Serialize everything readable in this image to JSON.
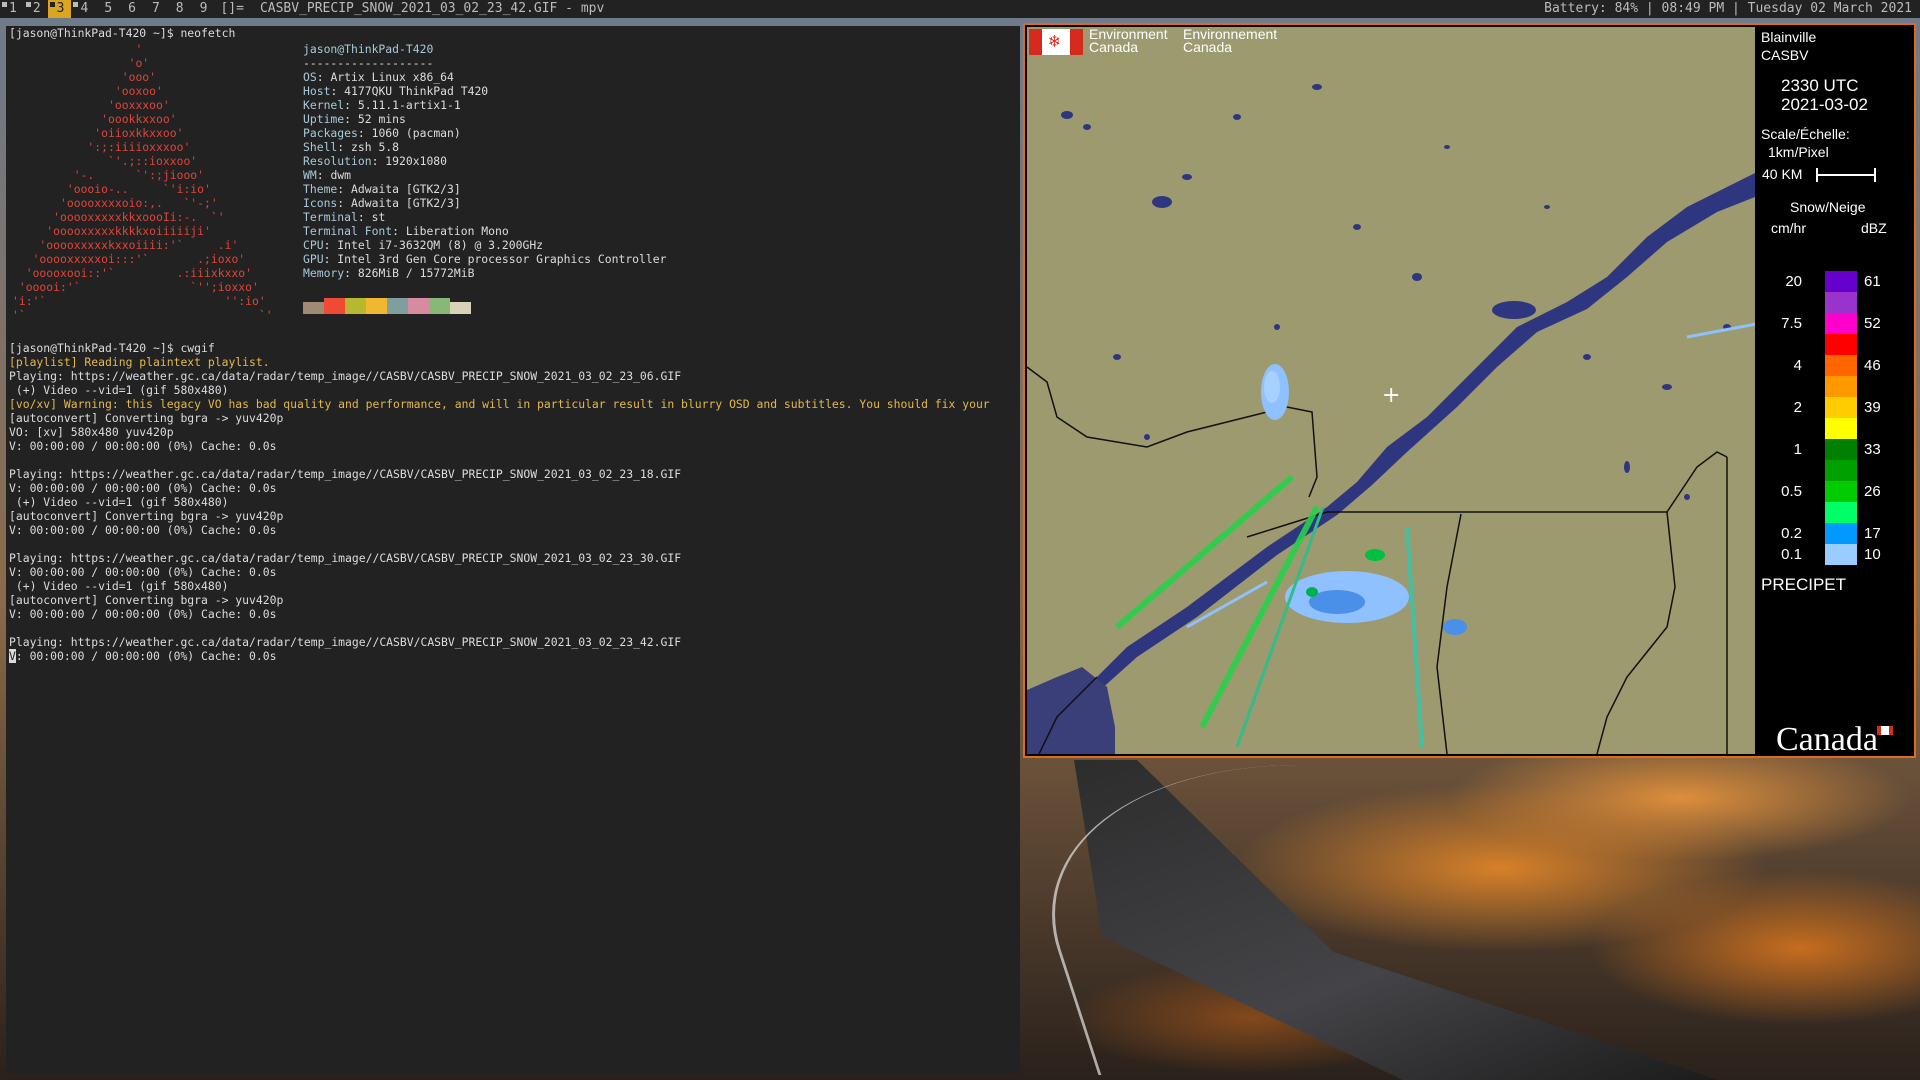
{
  "bar": {
    "tags": [
      {
        "label": "1",
        "occupied": true,
        "selected": false
      },
      {
        "label": "2",
        "occupied": true,
        "selected": false
      },
      {
        "label": "3",
        "occupied": true,
        "selected": true
      },
      {
        "label": "4",
        "occupied": true,
        "selected": false
      },
      {
        "label": "5",
        "occupied": false,
        "selected": false
      },
      {
        "label": "6",
        "occupied": false,
        "selected": false
      },
      {
        "label": "7",
        "occupied": false,
        "selected": false
      },
      {
        "label": "8",
        "occupied": false,
        "selected": false
      },
      {
        "label": "9",
        "occupied": false,
        "selected": false
      }
    ],
    "layout": "[]=",
    "title": "CASBV_PRECIP_SNOW_2021_03_02_23_42.GIF - mpv",
    "status": "Battery: 84% | 08:49 PM | Tuesday 02 March 2021",
    "colors": {
      "bg": "#222222",
      "fg": "#bbbbbb",
      "accent": "#daa520"
    }
  },
  "terminal": {
    "prompt1": "[jason@ThinkPad-T420 ~]$ neofetch",
    "ascii_art": "                  '\n                 'o'\n                'ooo'\n               'ooxoo'\n              'ooxxxoo'\n             'oookkxxoo'\n            'oiioxkkxxoo'\n           ':;:iiiioxxxoo'\n              `'.;::ioxxoo'\n         '-.      `':;jiooo'\n        'oooio-..     `'i:io'\n       'ooooxxxxoio:,.   `'-;'\n      'ooooxxxxxkkxoooIi:-.  `'\n     'ooooxxxxxkkkkxoiiiiiji'\n    'ooooxxxxxkxxoiiii:'`     .i'\n   'ooooxxxxxoi:::'`       .;ioxo'\n  'ooooxooi::'`         .:iiixkxxo'\n 'ooooi:'`                `'';ioxxo'\n'i:'`                          '':io'\n'`                                  `'",
    "user": "jason@ThinkPad-T420",
    "separator": "-------------------",
    "info": [
      {
        "key": "OS",
        "value": "Artix Linux x86_64"
      },
      {
        "key": "Host",
        "value": "4177QKU ThinkPad T420"
      },
      {
        "key": "Kernel",
        "value": "5.11.1-artix1-1"
      },
      {
        "key": "Uptime",
        "value": "52 mins"
      },
      {
        "key": "Packages",
        "value": "1060 (pacman)"
      },
      {
        "key": "Shell",
        "value": "zsh 5.8"
      },
      {
        "key": "Resolution",
        "value": "1920x1080"
      },
      {
        "key": "WM",
        "value": "dwm"
      },
      {
        "key": "Theme",
        "value": "Adwaita [GTK2/3]"
      },
      {
        "key": "Icons",
        "value": "Adwaita [GTK2/3]"
      },
      {
        "key": "Terminal",
        "value": "st"
      },
      {
        "key": "Terminal Font",
        "value": "Liberation Mono"
      },
      {
        "key": "CPU",
        "value": "Intel i7-3632QM (8) @ 3.200GHz"
      },
      {
        "key": "GPU",
        "value": "Intel 3rd Gen Core processor Graphics Controller"
      },
      {
        "key": "Memory",
        "value": "826MiB / 15772MiB"
      }
    ],
    "palette": [
      "#a08a74",
      "#f04a35",
      "#b8b830",
      "#f0b830",
      "#7f9f9f",
      "#d88aa0",
      "#88b878",
      "#d8d2b8"
    ],
    "lines": [
      {
        "text": "[jason@ThinkPad-T420 ~]$ cwgif",
        "color": "white"
      },
      {
        "text": "[playlist] Reading plaintext playlist.",
        "color": "yellow"
      },
      {
        "text": "Playing: https://weather.gc.ca/data/radar/temp_image//CASBV/CASBV_PRECIP_SNOW_2021_03_02_23_06.GIF",
        "color": "white"
      },
      {
        "text": " (+) Video --vid=1 (gif 580x480)",
        "color": "white"
      },
      {
        "text": "[vo/xv] Warning: this legacy VO has bad quality and performance, and will in particular result in blurry OSD and subtitles. You should fix your",
        "color": "yellow"
      },
      {
        "text": "[autoconvert] Converting bgra -> yuv420p",
        "color": "white"
      },
      {
        "text": "VO: [xv] 580x480 yuv420p",
        "color": "white"
      },
      {
        "text": "V: 00:00:00 / 00:00:00 (0%) Cache: 0.0s",
        "color": "white"
      },
      {
        "text": "",
        "color": "white"
      },
      {
        "text": "Playing: https://weather.gc.ca/data/radar/temp_image//CASBV/CASBV_PRECIP_SNOW_2021_03_02_23_18.GIF",
        "color": "white"
      },
      {
        "text": "V: 00:00:00 / 00:00:00 (0%) Cache: 0.0s",
        "color": "white"
      },
      {
        "text": " (+) Video --vid=1 (gif 580x480)",
        "color": "white"
      },
      {
        "text": "[autoconvert] Converting bgra -> yuv420p",
        "color": "white"
      },
      {
        "text": "V: 00:00:00 / 00:00:00 (0%) Cache: 0.0s",
        "color": "white"
      },
      {
        "text": "",
        "color": "white"
      },
      {
        "text": "Playing: https://weather.gc.ca/data/radar/temp_image//CASBV/CASBV_PRECIP_SNOW_2021_03_02_23_30.GIF",
        "color": "white"
      },
      {
        "text": "V: 00:00:00 / 00:00:00 (0%) Cache: 0.0s",
        "color": "white"
      },
      {
        "text": " (+) Video --vid=1 (gif 580x480)",
        "color": "white"
      },
      {
        "text": "[autoconvert] Converting bgra -> yuv420p",
        "color": "white"
      },
      {
        "text": "V: 00:00:00 / 00:00:00 (0%) Cache: 0.0s",
        "color": "white"
      },
      {
        "text": "",
        "color": "white"
      },
      {
        "text": "Playing: https://weather.gc.ca/data/radar/temp_image//CASBV/CASBV_PRECIP_SNOW_2021_03_02_23_42.GIF",
        "color": "white"
      },
      {
        "text": "V: 00:00:00 / 00:00:00 (0%) Cache: 0.0s",
        "color": "white",
        "cursor": true
      }
    ],
    "colors": {
      "bg": "#222222",
      "fg": "#dcdcdc",
      "warn": "#e5b84a",
      "ascii": "#e0453a",
      "key": "#a8c8d8"
    }
  },
  "radar": {
    "header_en": "Environment\nCanada",
    "header_fr": "Environnement\nCanada",
    "station_name": "Blainville",
    "station_id": "CASBV",
    "time": "2330 UTC",
    "date": "2021-03-02",
    "scale_label": "Scale/Échelle:",
    "scale_value": "1km/Pixel",
    "distance": "40 KM",
    "legend_title": "Snow/Neige",
    "unit_left": "cm/hr",
    "unit_right": "dBZ",
    "scale_rows": [
      {
        "rate": "20",
        "dbz": "61",
        "color": "#6600cc"
      },
      {
        "rate": "",
        "dbz": "",
        "color": "#9933cc"
      },
      {
        "rate": "7.5",
        "dbz": "52",
        "color": "#ff00cc"
      },
      {
        "rate": "",
        "dbz": "",
        "color": "#ff0000"
      },
      {
        "rate": "4",
        "dbz": "46",
        "color": "#ff6600"
      },
      {
        "rate": "",
        "dbz": "",
        "color": "#ff9900"
      },
      {
        "rate": "2",
        "dbz": "39",
        "color": "#ffcc00"
      },
      {
        "rate": "",
        "dbz": "",
        "color": "#ffff00"
      },
      {
        "rate": "1",
        "dbz": "33",
        "color": "#008000"
      },
      {
        "rate": "",
        "dbz": "",
        "color": "#00a000"
      },
      {
        "rate": "0.5",
        "dbz": "26",
        "color": "#00cc00"
      },
      {
        "rate": "",
        "dbz": "",
        "color": "#00ff66"
      },
      {
        "rate": "0.2",
        "dbz": "17",
        "color": "#0099ff"
      },
      {
        "rate": "0.1",
        "dbz": "10",
        "color": "#99ccff"
      }
    ],
    "product": "PRECIPET",
    "wordmark": "Canada",
    "colors": {
      "land": "#9e9a6f",
      "water": "#3a3f7a",
      "border": "#e06b18",
      "echo": "#99ccff"
    }
  }
}
